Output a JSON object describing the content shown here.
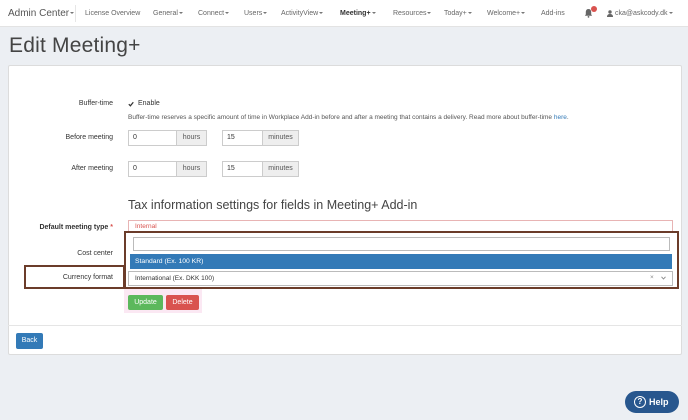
{
  "nav": {
    "brand": "Admin Center",
    "items": [
      "License Overview",
      "General",
      "Connect",
      "Users",
      "ActivityView",
      "Meeting+",
      "Resources",
      "Today+",
      "Welcome+",
      "Add-ins"
    ],
    "user": "cka@askcody.dk"
  },
  "page": {
    "title": "Edit Meeting+"
  },
  "buffer": {
    "label": "Buffer-time",
    "enable_label": "Enable",
    "enabled": true,
    "description": "Buffer-time reserves a specific amount of time in Workplace Add-in before and after a meeting that contains a delivery. Read more about buffer-time",
    "link": "here",
    "link_suffix": "."
  },
  "before": {
    "label": "Before meeting",
    "hours": "0",
    "hours_unit": "hours",
    "minutes": "15",
    "minutes_unit": "minutes"
  },
  "after": {
    "label": "After meeting",
    "hours": "0",
    "hours_unit": "hours",
    "minutes": "15",
    "minutes_unit": "minutes"
  },
  "tax": {
    "heading": "Tax information settings for fields in Meeting+ Add-in",
    "meeting_type_label": "Default meeting type",
    "meeting_type_required": "*",
    "meeting_type_value": "Internal",
    "cost_center_label": "Cost center",
    "dropdown_option": "Standard (Ex. 100 KR)",
    "currency_label": "Currency format",
    "currency_value": "International (Ex. DKK 100)"
  },
  "buttons": {
    "update": "Update",
    "delete": "Delete",
    "back": "Back"
  },
  "help": "Help",
  "colors": {
    "primary": "#337ab7",
    "success": "#5cb85c",
    "danger": "#d9534f",
    "highlight": "#6b3c2a",
    "help": "#28578e"
  }
}
